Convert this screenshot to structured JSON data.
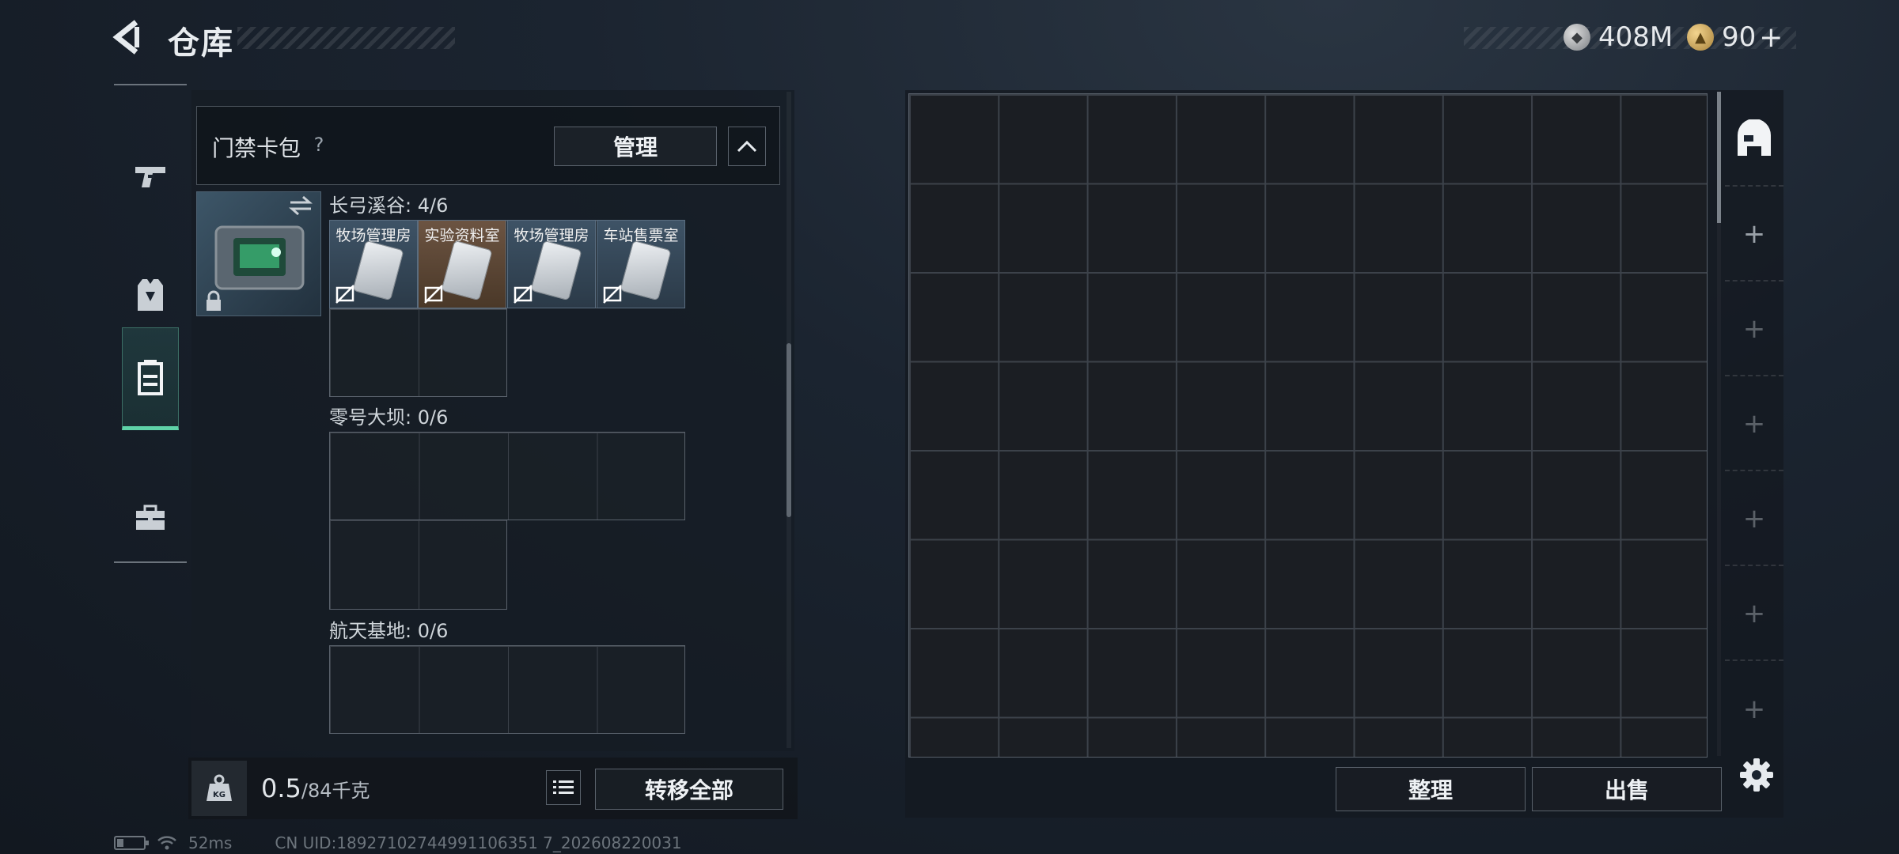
{
  "header": {
    "title": "仓库",
    "currencies": [
      {
        "icon": "silver-coin-icon",
        "value": "408M"
      },
      {
        "icon": "gold-coin-icon",
        "value": "90"
      }
    ],
    "plus": "+"
  },
  "categories": [
    {
      "name": "weapons",
      "icon": "gun-icon"
    },
    {
      "name": "equipment",
      "icon": "armor-icon"
    },
    {
      "name": "keycards",
      "icon": "keycard-case-icon",
      "active": true
    },
    {
      "name": "items",
      "icon": "toolbox-icon"
    }
  ],
  "key_case": {
    "title": "门禁卡包",
    "help": "?",
    "manage": "管理",
    "sections": [
      {
        "label": "长弓溪谷: 4/6",
        "keys": [
          "牧场管理房",
          "实验资料室",
          "牧场管理房",
          "车站售票室"
        ]
      },
      {
        "label": "零号大坝: 0/6"
      },
      {
        "label": "航天基地: 0/6"
      }
    ]
  },
  "bottom_left": {
    "weight_icon": "KG",
    "weight_current": "0.5",
    "weight_max": "/84千克",
    "transfer_all": "转移全部"
  },
  "stash": {
    "sort": "整理",
    "sell": "出售"
  },
  "status": {
    "ping": "52ms",
    "uid": "CN UID:18927102744991106351 7_202608220031"
  }
}
